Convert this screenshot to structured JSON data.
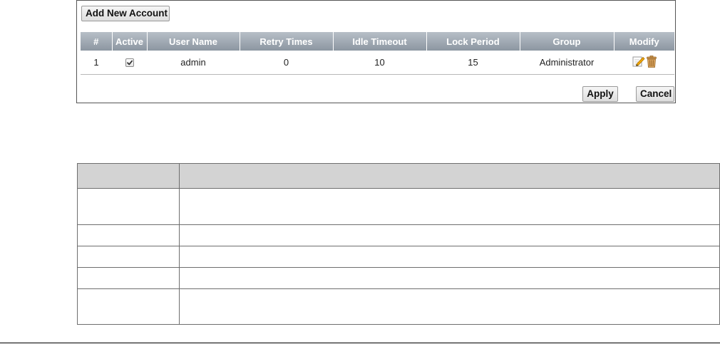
{
  "toolbar": {
    "add_label": "Add New Account",
    "apply_label": "Apply",
    "cancel_label": "Cancel"
  },
  "table": {
    "headers": {
      "index": "#",
      "active": "Active",
      "user_name": "User Name",
      "retry_times": "Retry Times",
      "idle_timeout": "Idle Timeout",
      "lock_period": "Lock Period",
      "group": "Group",
      "modify": "Modify"
    },
    "rows": [
      {
        "index": "1",
        "active": true,
        "user_name": "admin",
        "retry_times": "0",
        "idle_timeout": "10",
        "lock_period": "15",
        "group": "Administrator"
      }
    ]
  },
  "icons": {
    "edit": "edit-icon",
    "delete": "trash-icon",
    "checkmark": "checkmark-icon"
  },
  "colors": {
    "header_bg_top": "#b7bfc7",
    "header_bg_bottom": "#8c96a1",
    "doc_header_bg": "#d3d3d3"
  }
}
